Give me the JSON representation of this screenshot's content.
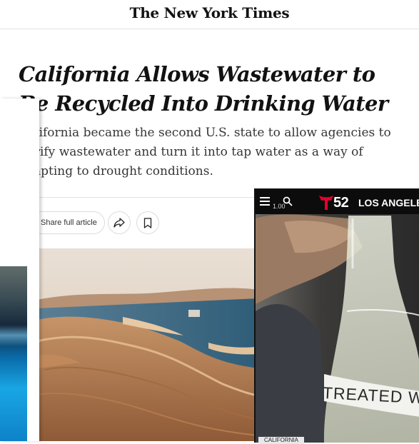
{
  "masthead": {
    "logo": "The New York Times"
  },
  "article": {
    "headline": "California Allows Wastewater to Be Recycled Into Drinking Water",
    "summary": "California became the second U.S. state to allow agencies to purify wastewater and turn it into tap water as a way of adapting to drought conditions.",
    "share_label": "Share full article"
  },
  "video": {
    "speed": "1.00",
    "station_number": "52",
    "station_city": "LOS ANGELES",
    "beaker_label": "TREATED WAS",
    "caption_tag": "CALIFORNIA"
  },
  "icons": {
    "share": "share-arrow-icon",
    "save": "bookmark-icon",
    "menu": "hamburger-menu-icon",
    "search": "search-icon",
    "brand": "telemundo-t-logo"
  },
  "colors": {
    "nyt_text": "#121212",
    "summary_text": "#363636",
    "telemundo_red": "#e4002b",
    "video_bar": "#0c0c0c"
  }
}
